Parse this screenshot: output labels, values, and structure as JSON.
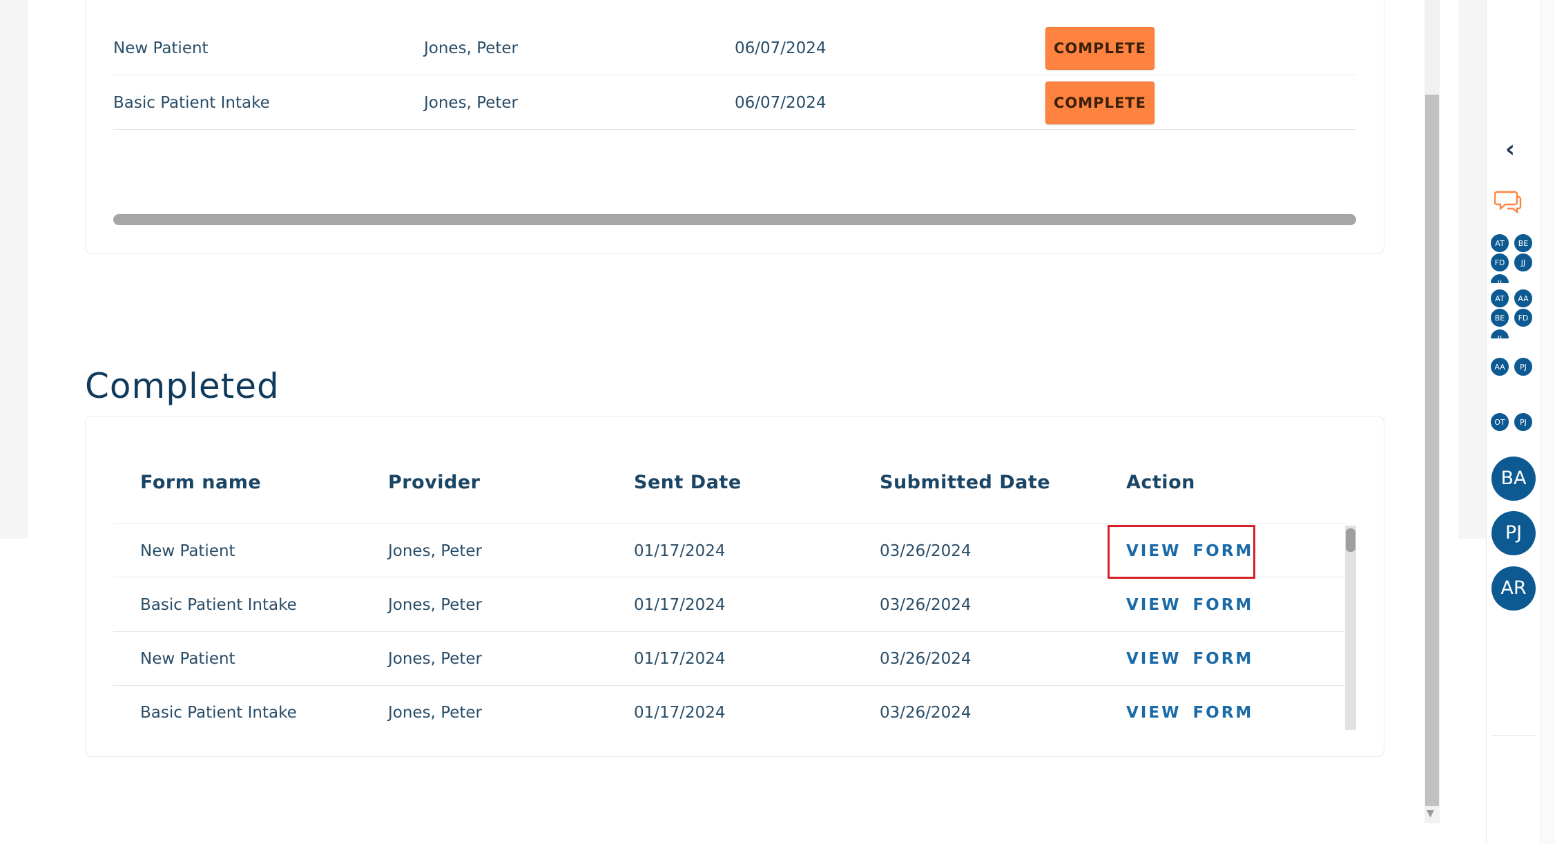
{
  "pending": {
    "rows": [
      {
        "form_name": "New Patient",
        "provider": "Jones, Peter",
        "sent_date": "06/07/2024",
        "action": "COMPLETE"
      },
      {
        "form_name": "Basic Patient Intake",
        "provider": "Jones, Peter",
        "sent_date": "06/07/2024",
        "action": "COMPLETE"
      }
    ]
  },
  "completed": {
    "title": "Completed",
    "headers": {
      "form_name": "Form name",
      "provider": "Provider",
      "sent_date": "Sent Date",
      "submitted_date": "Submitted Date",
      "action": "Action"
    },
    "rows": [
      {
        "form_name": "New Patient",
        "provider": "Jones, Peter",
        "sent_date": "01/17/2024",
        "submitted_date": "03/26/2024",
        "action": "VIEW FORM"
      },
      {
        "form_name": "Basic Patient Intake",
        "provider": "Jones, Peter",
        "sent_date": "01/17/2024",
        "submitted_date": "03/26/2024",
        "action": "VIEW FORM"
      },
      {
        "form_name": "New Patient",
        "provider": "Jones, Peter",
        "sent_date": "01/17/2024",
        "submitted_date": "03/26/2024",
        "action": "VIEW FORM"
      },
      {
        "form_name": "Basic Patient Intake",
        "provider": "Jones, Peter",
        "sent_date": "01/17/2024",
        "submitted_date": "03/26/2024",
        "action": "VIEW FORM"
      }
    ]
  },
  "sidebar": {
    "collapse_icon": "chevron-left-icon",
    "chat_icon": "chat-bubbles-icon",
    "groups": [
      [
        "AT",
        "BE",
        "FD",
        "JJ",
        "JJ"
      ],
      [
        "AT",
        "AA",
        "BE",
        "FD",
        "JJ"
      ],
      [
        "AA",
        "PJ"
      ],
      [
        "OT",
        "PJ"
      ]
    ],
    "avatars": [
      "BA",
      "PJ",
      "AR"
    ]
  },
  "colors": {
    "accent_orange": "#ff8340",
    "link_blue": "#1a6aa8",
    "avatar_blue": "#0d5a93",
    "highlight_red": "#d9202a"
  }
}
